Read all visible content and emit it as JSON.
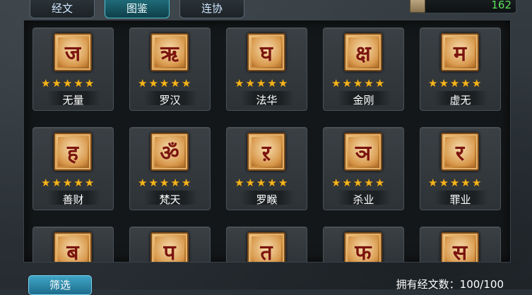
{
  "tabs": [
    {
      "label": "经文",
      "active": false
    },
    {
      "label": "图鉴",
      "active": true
    },
    {
      "label": "连协",
      "active": false
    }
  ],
  "resource": {
    "value": "162",
    "icon": "scroll-icon"
  },
  "cards": [
    {
      "name": "无量",
      "glyph": "ज",
      "stars": 5
    },
    {
      "name": "罗汉",
      "glyph": "ऋ",
      "stars": 5
    },
    {
      "name": "法华",
      "glyph": "घ",
      "stars": 5
    },
    {
      "name": "金刚",
      "glyph": "क्ष",
      "stars": 5
    },
    {
      "name": "虚无",
      "glyph": "म",
      "stars": 5
    },
    {
      "name": "善财",
      "glyph": "ह",
      "stars": 5
    },
    {
      "name": "梵天",
      "glyph": "ॐ",
      "stars": 5
    },
    {
      "name": "罗睺",
      "glyph": "ऱ",
      "stars": 5
    },
    {
      "name": "杀业",
      "glyph": "ञ",
      "stars": 5
    },
    {
      "name": "罪业",
      "glyph": "र",
      "stars": 5
    },
    {
      "name": "",
      "glyph": "ब",
      "stars": 0
    },
    {
      "name": "",
      "glyph": "प",
      "stars": 0
    },
    {
      "name": "",
      "glyph": "त",
      "stars": 0
    },
    {
      "name": "",
      "glyph": "फ",
      "stars": 0
    },
    {
      "name": "",
      "glyph": "स",
      "stars": 0
    }
  ],
  "footer": {
    "filter_label": "筛选",
    "count_text": "拥有经文数：100/100"
  },
  "colors": {
    "accent": "#4fc0d0",
    "star": "#f5b51c",
    "resource_value": "#5de05a"
  }
}
